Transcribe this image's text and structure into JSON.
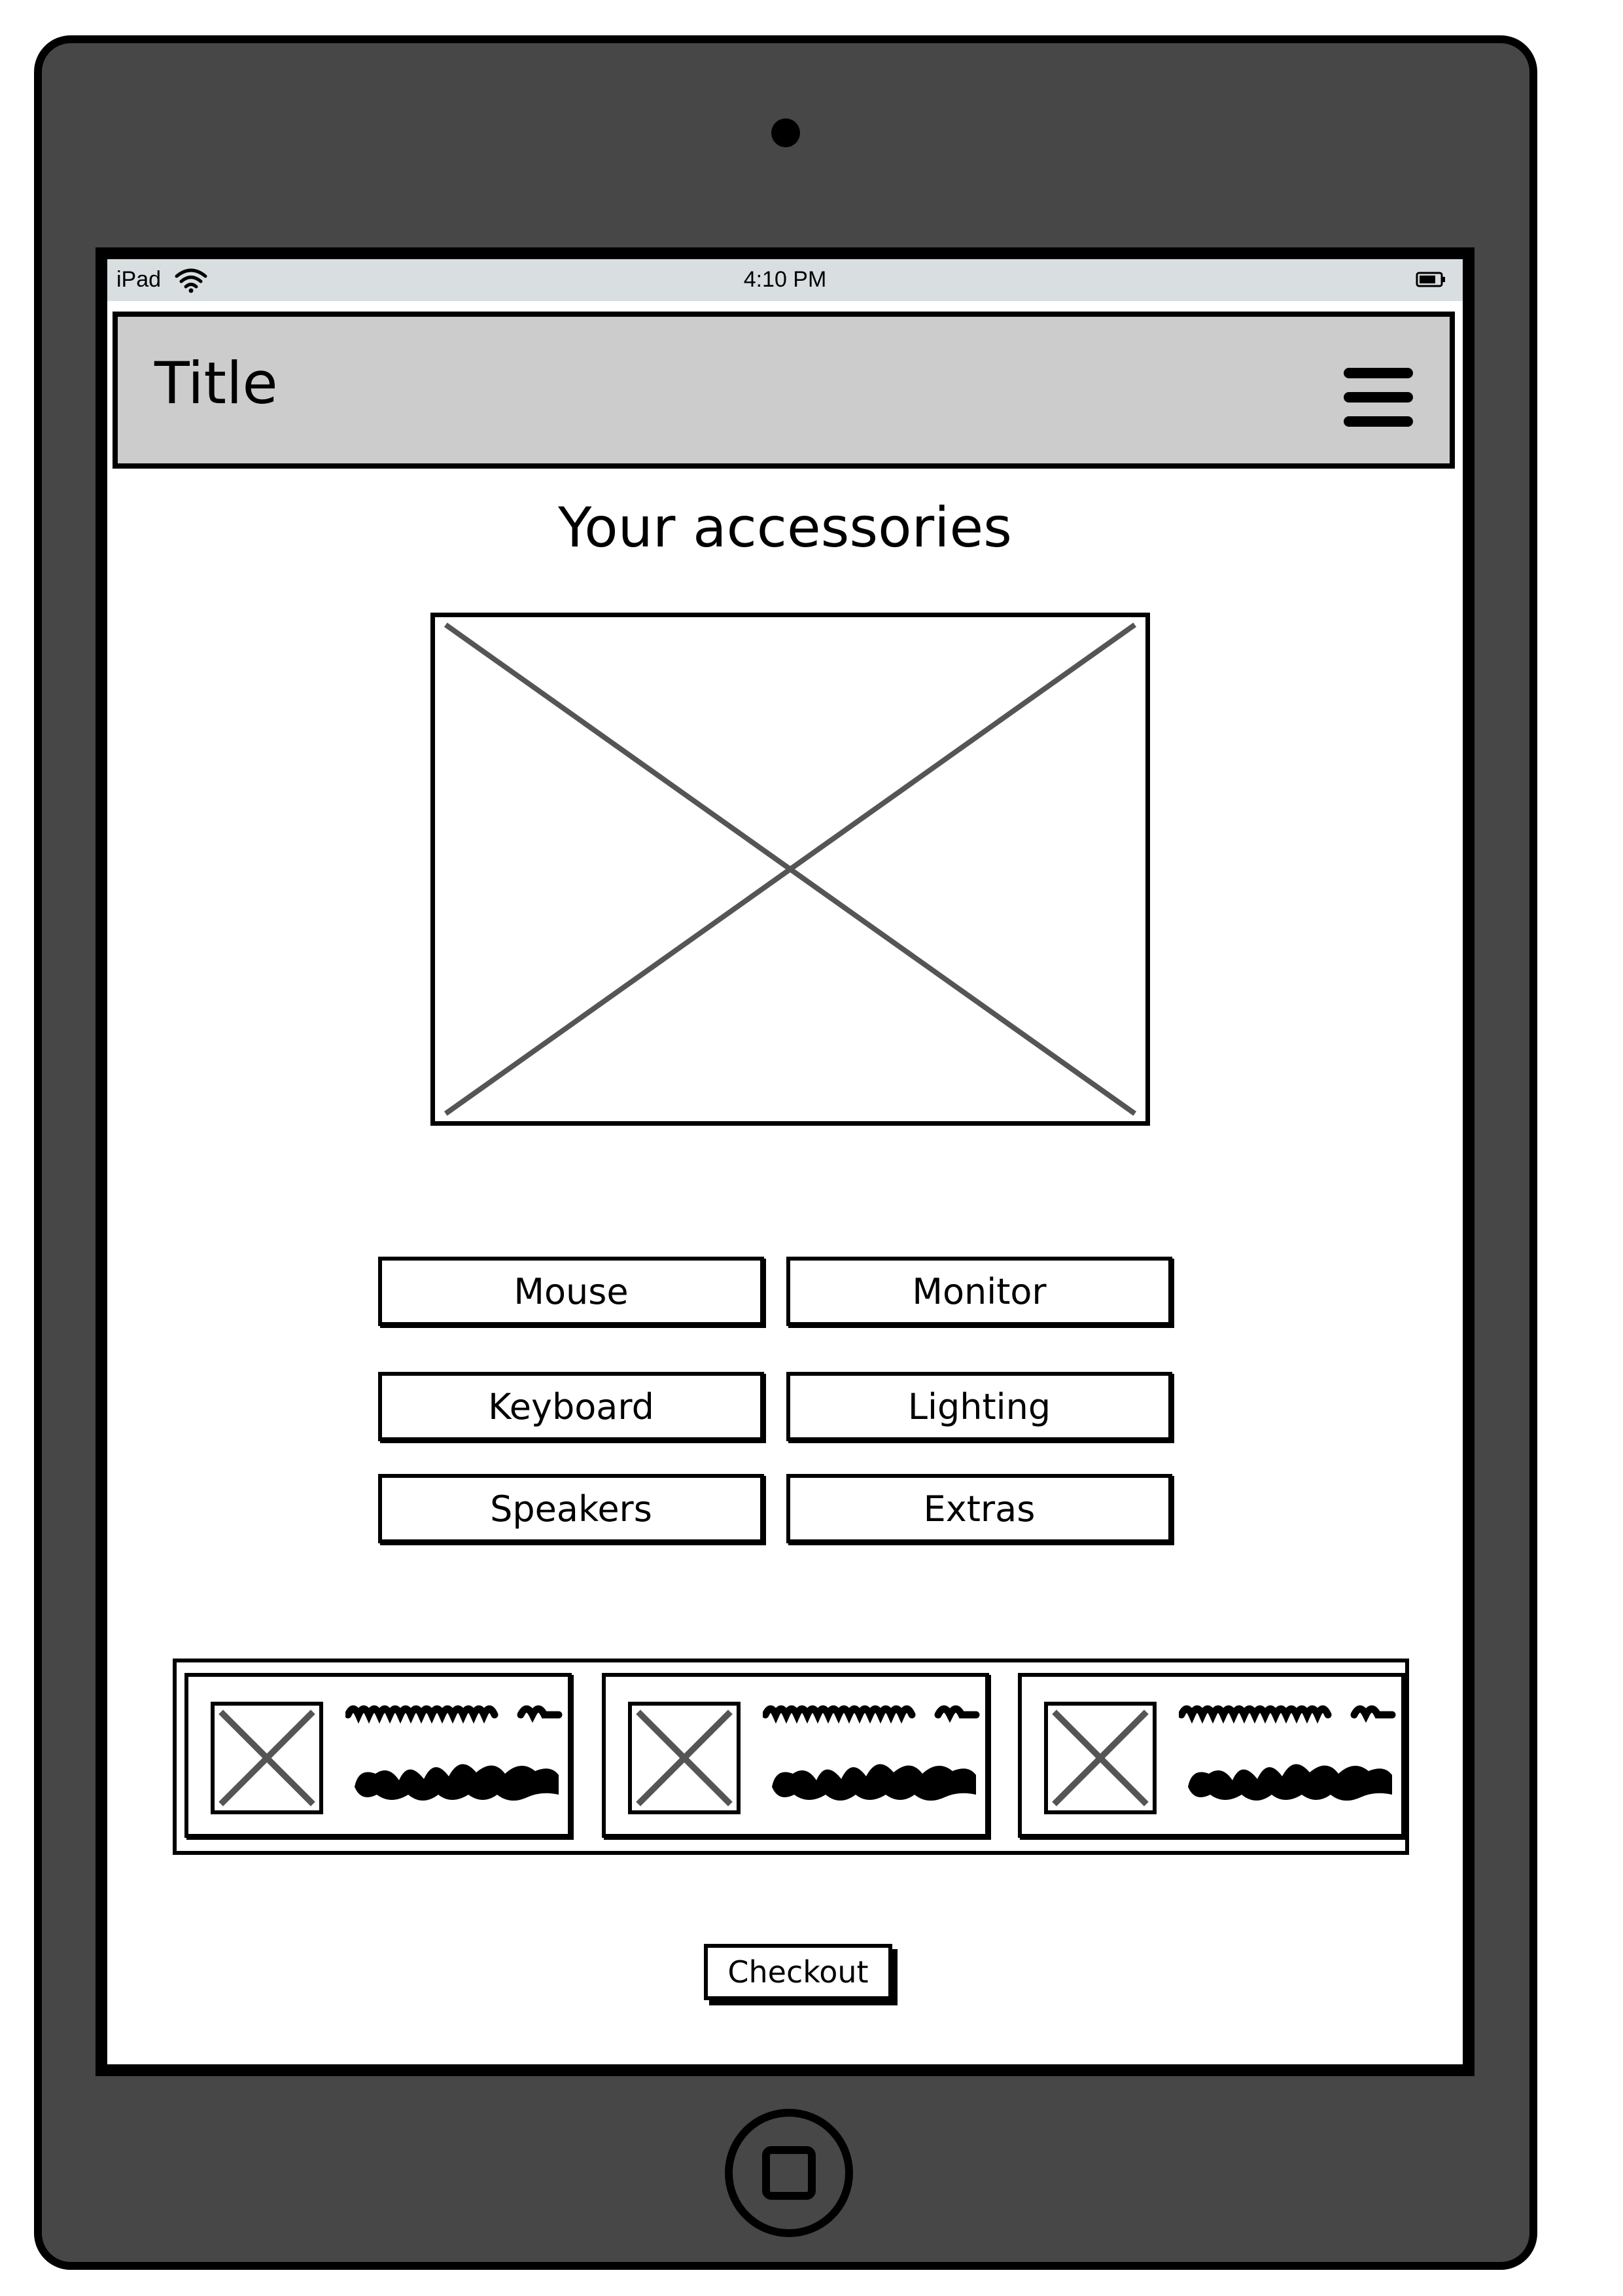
{
  "status_bar": {
    "device": "iPad",
    "time": "4:10 PM",
    "wifi_icon": "wifi-icon",
    "battery_icon": "battery-icon"
  },
  "navbar": {
    "title": "Title",
    "menu_icon": "hamburger-menu-icon"
  },
  "page": {
    "heading": "Your accessories",
    "hero_image": "image-placeholder"
  },
  "categories": [
    {
      "label": "Mouse"
    },
    {
      "label": "Monitor"
    },
    {
      "label": "Keyboard"
    },
    {
      "label": "Lighting"
    },
    {
      "label": "Speakers"
    },
    {
      "label": "Extras"
    }
  ],
  "carousel": {
    "items": [
      {
        "thumbnail": "image-placeholder"
      },
      {
        "thumbnail": "image-placeholder"
      },
      {
        "thumbnail": "image-placeholder"
      }
    ]
  },
  "checkout": {
    "label": "Checkout"
  },
  "device": {
    "home_button": "home-button-icon"
  },
  "colors": {
    "device_body": "#474747",
    "status_bar": "#d9dee1",
    "navbar": "#cccccc",
    "placeholder_cross": "#555555"
  }
}
